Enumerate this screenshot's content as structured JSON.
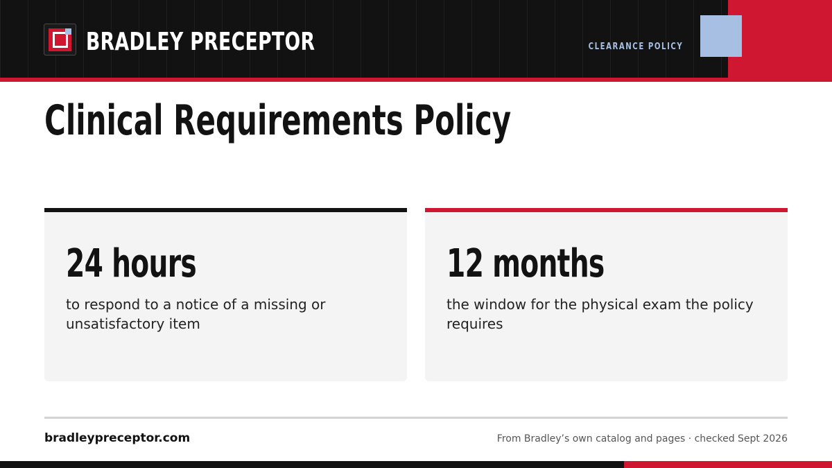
{
  "header": {
    "brand_name": "BRADLEY PRECEPTOR",
    "logo_icon": "brand-logo-icon",
    "section_label": "CLEARANCE POLICY"
  },
  "main": {
    "title": "Clinical Requirements Policy",
    "stats": [
      {
        "value": "24 hours",
        "description": "to respond to a notice of a missing or unsatisfactory item",
        "accent": "#121212"
      },
      {
        "value": "12 months",
        "description": "the window for the physical exam the policy requires",
        "accent": "#cf1731"
      }
    ]
  },
  "footer": {
    "url": "bradleypreceptor.com",
    "source_note": "From Bradley’s own catalog and pages · checked Sept 2026"
  },
  "colors": {
    "dark": "#121212",
    "brand_red": "#cf1731",
    "accent_blue": "#a6bfe3",
    "card_bg": "#f4f4f4"
  }
}
